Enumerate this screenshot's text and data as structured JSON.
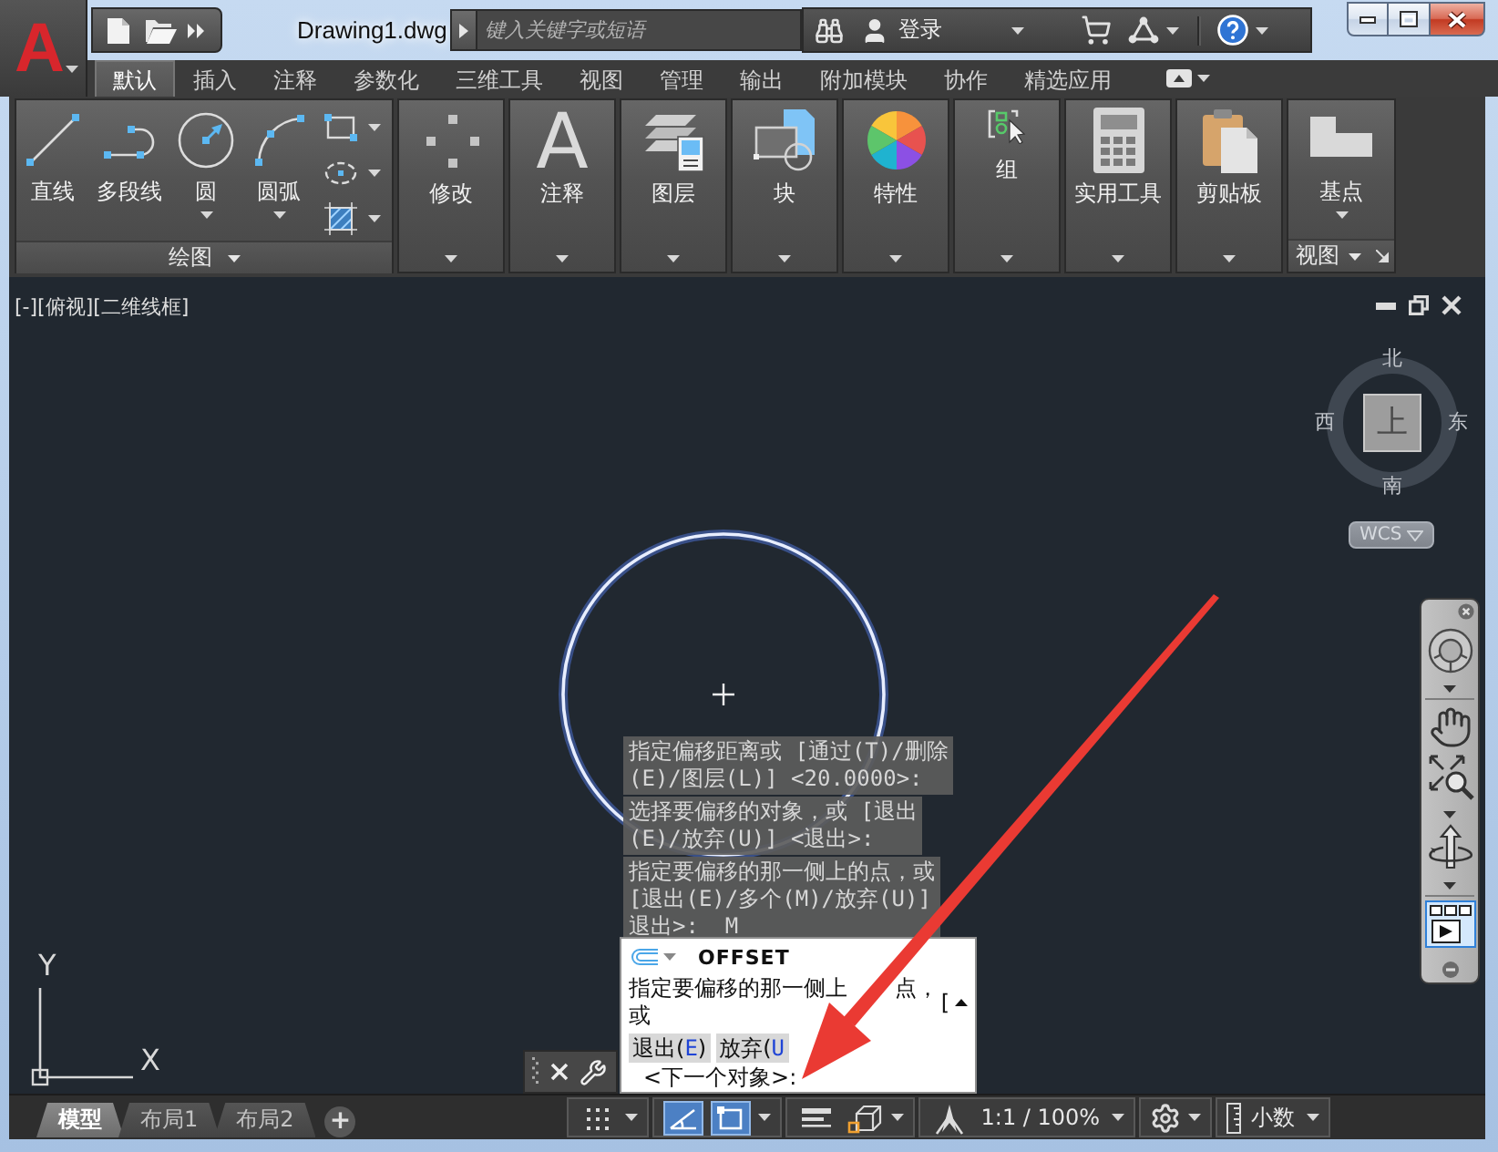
{
  "app_menu": {
    "label": "A"
  },
  "title_bar": {
    "title": "Drawing1.dwg",
    "search": {
      "placeholder": "键入关键字或短语"
    },
    "sign_in": "登录"
  },
  "ribbon": {
    "tabs": [
      {
        "label": "默认",
        "selected": true
      },
      {
        "label": "插入",
        "selected": false
      },
      {
        "label": "注释",
        "selected": false
      },
      {
        "label": "参数化",
        "selected": false
      },
      {
        "label": "三维工具",
        "selected": false
      },
      {
        "label": "视图",
        "selected": false
      },
      {
        "label": "管理",
        "selected": false
      },
      {
        "label": "输出",
        "selected": false
      },
      {
        "label": "附加模块",
        "selected": false
      },
      {
        "label": "协作",
        "selected": false
      },
      {
        "label": "精选应用",
        "selected": false
      }
    ],
    "panels": [
      {
        "kind": "draw",
        "title": "绘图",
        "tools": [
          {
            "label": "直线",
            "dropdown": false
          },
          {
            "label": "多段线",
            "dropdown": false
          },
          {
            "label": "圆",
            "dropdown": true
          },
          {
            "label": "圆弧",
            "dropdown": true
          }
        ]
      },
      {
        "kind": "collapsed",
        "title": "修改"
      },
      {
        "kind": "collapsed",
        "title": "注释",
        "glyph": "A"
      },
      {
        "kind": "collapsed",
        "title": "图层"
      },
      {
        "kind": "collapsed",
        "title": "块"
      },
      {
        "kind": "collapsed",
        "title": "特性"
      },
      {
        "kind": "compact",
        "title": "组"
      },
      {
        "kind": "collapsed",
        "title": "实用工具"
      },
      {
        "kind": "collapsed",
        "title": "剪贴板"
      },
      {
        "kind": "view",
        "title": "视图",
        "tools": [
          {
            "label": "基点",
            "dropdown": true
          }
        ]
      }
    ]
  },
  "viewport": {
    "label": "[-][俯视][二维线框]"
  },
  "viewcube": {
    "north": "北",
    "south": "南",
    "west": "西",
    "east": "东",
    "face": "上",
    "coordinate_system": "WCS"
  },
  "navigation_bar": {
    "tools": [
      {
        "kind": "wheel",
        "dropdown": true,
        "selected": false
      },
      {
        "kind": "pan",
        "dropdown": false,
        "selected": false
      },
      {
        "kind": "zoom",
        "dropdown": true,
        "selected": false
      },
      {
        "kind": "orbit",
        "dropdown": true,
        "selected": false
      },
      {
        "kind": "showmotion",
        "dropdown": false,
        "selected": true
      }
    ]
  },
  "command_history": [
    {
      "lines": [
        "指定偏移距离或 [通过(T)/删除",
        "(E)/图层(L)] <20.0000>:"
      ]
    },
    {
      "lines": [
        "选择要偏移的对象，或 [退出",
        "(E)/放弃(U)] <退出>:"
      ]
    },
    {
      "lines": [
        "指定要偏移的那一侧上的点，或",
        "[退出(E)/多个(M)/放弃(U)]",
        "退出>:  M"
      ]
    }
  ],
  "command_line": {
    "command": "OFFSET",
    "prompt_lines": [
      [
        "指定要偏移的那一侧上",
        "点，"
      ],
      [
        "或"
      ]
    ],
    "prompt_continuation": "[",
    "options": [
      {
        "text": "退出(",
        "key": "E",
        "close": ")"
      },
      {
        "text": "放弃(",
        "key": "U"
      }
    ],
    "input": "<下一个对象>:"
  },
  "ucs_icon": {
    "x_label": "X",
    "y_label": "Y"
  },
  "status_bar": {
    "layout_tabs": [
      {
        "label": "模型",
        "selected": true
      },
      {
        "label": "布局1",
        "selected": false
      },
      {
        "label": "布局2",
        "selected": false
      }
    ],
    "add_tab": "+",
    "toggles": [
      {
        "kind": "grid",
        "on": false,
        "dropdown": true
      },
      {
        "kind": "polar",
        "on": true,
        "dropdown": false
      },
      {
        "kind": "osnap",
        "on": true,
        "dropdown": true
      },
      {
        "kind": "lineweight",
        "on": false,
        "dropdown": false
      },
      {
        "kind": "isometric",
        "on": false,
        "dropdown": true
      },
      {
        "kind": "annotation",
        "on": false,
        "dropdown": false
      }
    ],
    "scale": "1:1 / 100%",
    "units": "小数"
  }
}
